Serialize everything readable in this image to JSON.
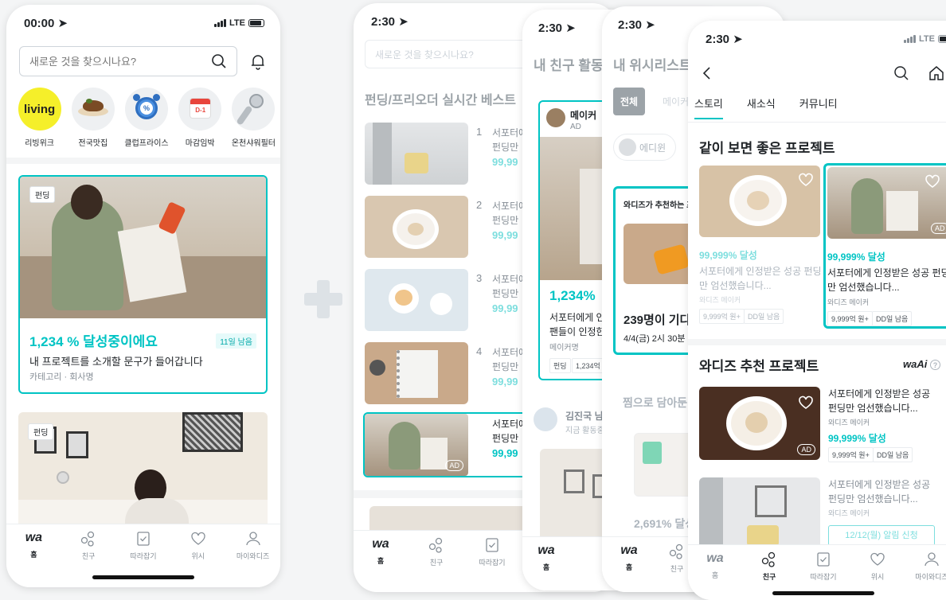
{
  "colors": {
    "accent": "#00c4c4",
    "text": "#212529",
    "muted": "#9ca3a8"
  },
  "status": {
    "time1": "00:00",
    "time2": "2:30",
    "carrier": "LTE"
  },
  "p1": {
    "search_placeholder": "새로운 것을 찾으시나요?",
    "categories": [
      {
        "label": "리빙위크",
        "logo": "living"
      },
      {
        "label": "전국맛집",
        "icon": "food-icon"
      },
      {
        "label": "클럽프라이스",
        "icon": "alarm-clock-icon"
      },
      {
        "label": "마감임박",
        "icon": "calendar-icon",
        "calendar_text": "D-1"
      },
      {
        "label": "온천샤워필터",
        "icon": "shower-head-icon"
      }
    ],
    "card1": {
      "badge": "펀딩",
      "achieve": "1,234 % 달성중이에요",
      "days": "11일 남음",
      "title": "내 프로젝트를 소개할 문구가 들어갑니다",
      "meta": "카테고리 · 회사명"
    },
    "card2": {
      "badge": "펀딩"
    }
  },
  "tabbar": {
    "logo": "wa",
    "items": [
      "홈",
      "친구",
      "따라잡기",
      "위시",
      "마이와디즈"
    ]
  },
  "p2": {
    "search_placeholder": "새로운 것을 찾으시나요?",
    "section": "펀딩/프리오더 실시간 베스트",
    "items": [
      {
        "rank": "1",
        "l1": "서포터에",
        "l2": "펀딩만",
        "pct": "99,99"
      },
      {
        "rank": "2",
        "l1": "서포터에",
        "l2": "펀딩만",
        "pct": "99,99"
      },
      {
        "rank": "3",
        "l1": "서포터에",
        "l2": "펀딩만",
        "pct": "99,99"
      },
      {
        "rank": "4",
        "l1": "서포터에",
        "l2": "펀딩만",
        "pct": "99,99"
      },
      {
        "rank": "",
        "l1": "서포터에",
        "l2": "펀딩만",
        "pct": "99,99",
        "ad": "AD"
      }
    ]
  },
  "p3": {
    "title": "내 친구 활동",
    "maker": "메이커",
    "ad": "AD",
    "pct": "1,234%",
    "d1": "서포터에게 인",
    "d2": "팬들이 인정한",
    "maker_name": "메이커명",
    "chips": [
      "펀딩",
      "1,234억"
    ],
    "friend": "김진국 님",
    "friend_sub": "지금 활동중"
  },
  "p4": {
    "title": "내 위시리스트",
    "tabs": [
      "전체",
      "메이커"
    ],
    "filter": "에디윈",
    "rec": "와디즈가 추천하는 프",
    "wait": "239명이 기다",
    "date": "4/4(금) 2시 30분",
    "jjim": "찜으로 담아둔",
    "pct": "2,691% 달성"
  },
  "p5": {
    "tabs": [
      "스토리",
      "새소식",
      "커뮤니티"
    ],
    "sec1": "같이 보면 좋은 프로젝트",
    "cards": [
      {
        "pct": "99,999% 달성",
        "d1": "서포터에게 인정받은 성공 펀딩",
        "d2": "만 엄선했습니다...",
        "maker": "와디즈 메이커",
        "chips": [
          "9,999억 원+",
          "DD일 남음"
        ]
      },
      {
        "pct": "99,999% 달성",
        "d1": "서포터에게 인정받은 성공 펀딩",
        "d2": "만 엄선했습니다...",
        "maker": "와디즈 메이커",
        "chips": [
          "9,999억 원+",
          "DD일 남음"
        ],
        "ad": "AD"
      }
    ],
    "sec2": "와디즈 추천 프로젝트",
    "waai": "waAi",
    "rec": [
      {
        "d1": "서포터에게 인정받은 성공",
        "d2": "펀딩만 엄선했습니다...",
        "maker": "와디즈 메이커",
        "pct": "99,999% 달성",
        "chips": [
          "9,999억 원+",
          "DD일 남음"
        ],
        "ad": "AD"
      },
      {
        "d1": "서포터에게 인정받은 성공",
        "d2": "펀딩만 엄선했습니다...",
        "maker": "와디즈 메이커",
        "btn": "12/12(월) 알림 신청"
      }
    ]
  }
}
